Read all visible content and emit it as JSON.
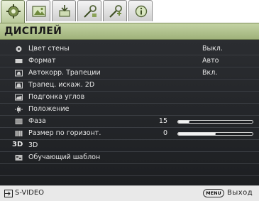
{
  "tabs": [
    {
      "icon": "display-settings-icon",
      "active": true
    },
    {
      "icon": "picture-icon",
      "active": false
    },
    {
      "icon": "source-icon",
      "active": false
    },
    {
      "icon": "system-setup-icon",
      "active": false
    },
    {
      "icon": "advanced-settings-icon",
      "active": false
    },
    {
      "icon": "information-icon",
      "active": false
    }
  ],
  "header": {
    "title": "ДИСПЛЕЙ"
  },
  "menu": {
    "items": [
      {
        "label": "Цвет стены",
        "value": "Выкл.",
        "icon": "wall-color-icon"
      },
      {
        "label": "Формат",
        "value": "Авто",
        "icon": "aspect-ratio-icon"
      },
      {
        "label": "Автокорр. Трапеции",
        "value": "Вкл.",
        "icon": "auto-keystone-icon"
      },
      {
        "label": "Трапец. искаж. 2D",
        "icon": "keystone-2d-icon"
      },
      {
        "label": "Подгонка углов",
        "icon": "corner-fit-icon"
      },
      {
        "label": "Положение",
        "icon": "position-icon"
      },
      {
        "label": "Фаза",
        "number": "15",
        "level": 0.15,
        "icon": "phase-icon"
      },
      {
        "label": "Размер по горизонт.",
        "number": "0",
        "level": 0.5,
        "icon": "h-size-icon"
      },
      {
        "label": "3D",
        "icon": "3d-icon",
        "icon_text": "3D"
      },
      {
        "label": "Обучающий шаблон",
        "icon": "test-pattern-icon"
      }
    ]
  },
  "footer": {
    "source": "S-VIDEO",
    "menu_key": "MENU",
    "exit": "Выход"
  },
  "colors": {
    "title_bar": "#b2c38c",
    "panel": "#25272b",
    "bottom_bar": "#e9e9e9"
  }
}
